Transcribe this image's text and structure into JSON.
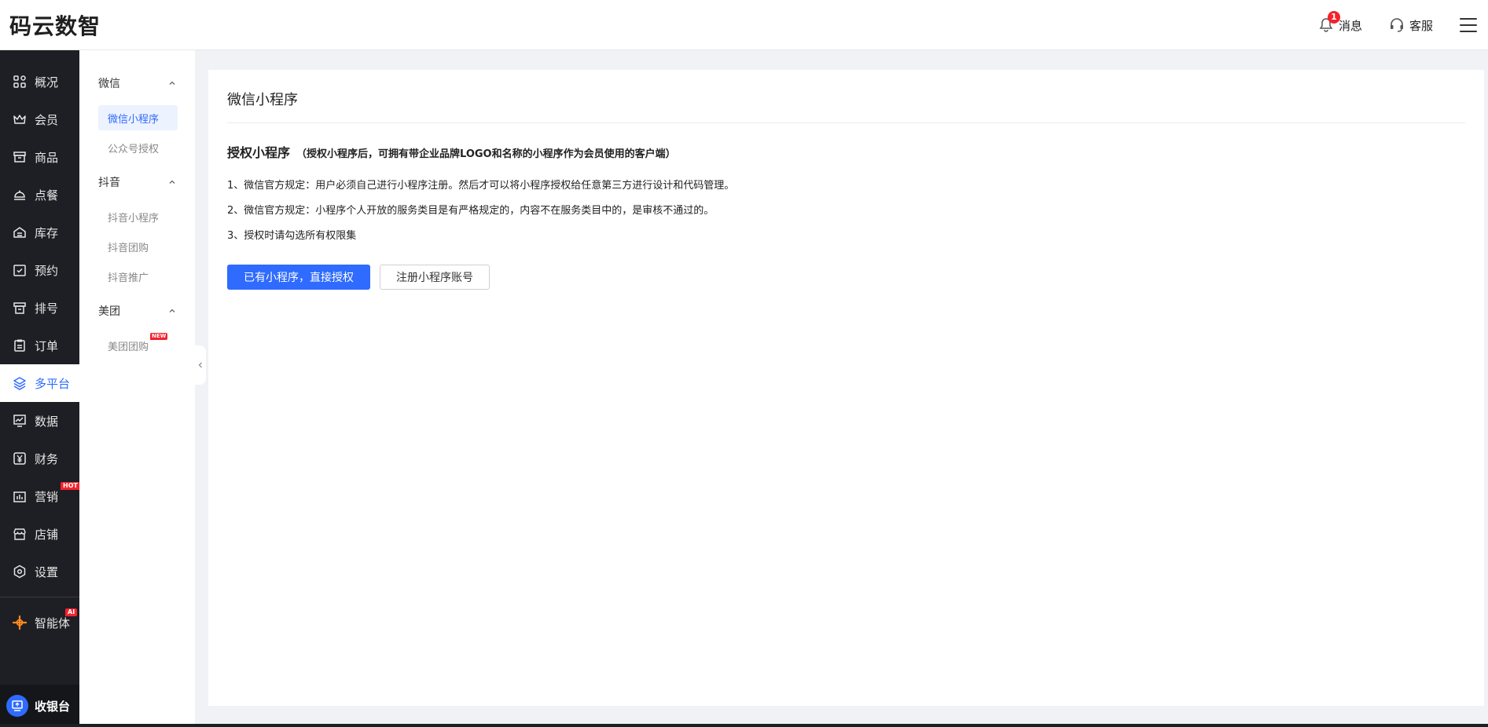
{
  "header": {
    "logo": "码云数智",
    "notifications_label": "消息",
    "notifications_count": "1",
    "service_label": "客服"
  },
  "leftnav": {
    "items": [
      {
        "label": "概况",
        "icon": "grid-icon"
      },
      {
        "label": "会员",
        "icon": "crown-icon"
      },
      {
        "label": "商品",
        "icon": "store-box-icon"
      },
      {
        "label": "点餐",
        "icon": "dish-cover-icon"
      },
      {
        "label": "库存",
        "icon": "inventory-icon"
      },
      {
        "label": "预约",
        "icon": "calendar-check-icon"
      },
      {
        "label": "排号",
        "icon": "queue-ticket-icon"
      },
      {
        "label": "订单",
        "icon": "clipboard-icon"
      },
      {
        "label": "多平台",
        "icon": "layers-icon",
        "active": true
      },
      {
        "label": "数据",
        "icon": "chart-icon"
      },
      {
        "label": "财务",
        "icon": "yen-icon"
      },
      {
        "label": "营销",
        "icon": "marketing-icon",
        "tag": "HOT"
      },
      {
        "label": "店铺",
        "icon": "shop-icon"
      },
      {
        "label": "设置",
        "icon": "settings-icon"
      }
    ],
    "ai_item": {
      "label": "智能体",
      "tag": "AI"
    },
    "cashier_label": "收银台"
  },
  "subnav": {
    "groups": [
      {
        "label": "微信",
        "items": [
          {
            "label": "微信小程序",
            "active": true
          },
          {
            "label": "公众号授权"
          }
        ]
      },
      {
        "label": "抖音",
        "items": [
          {
            "label": "抖音小程序"
          },
          {
            "label": "抖音团购"
          },
          {
            "label": "抖音推广"
          }
        ]
      },
      {
        "label": "美团",
        "items": [
          {
            "label": "美团团购",
            "tag": "NEW"
          }
        ]
      }
    ]
  },
  "main": {
    "title": "微信小程序",
    "section_title": "授权小程序",
    "section_subtitle": "（授权小程序后，可拥有带企业品牌LOGO和名称的小程序作为会员使用的客户端）",
    "rules": [
      "1、微信官方规定：用户必须自己进行小程序注册。然后才可以将小程序授权给任意第三方进行设计和代码管理。",
      "2、微信官方规定：小程序个人开放的服务类目是有严格规定的，内容不在服务类目中的，是审核不通过的。",
      "3、授权时请勾选所有权限集"
    ],
    "primary_button": "已有小程序，直接授权",
    "secondary_button": "注册小程序账号"
  },
  "colors": {
    "accent": "#2f6bff",
    "nav_bg": "#1e1f24",
    "badge": "#f5222d",
    "ai_icon": "#ff8a1f"
  }
}
